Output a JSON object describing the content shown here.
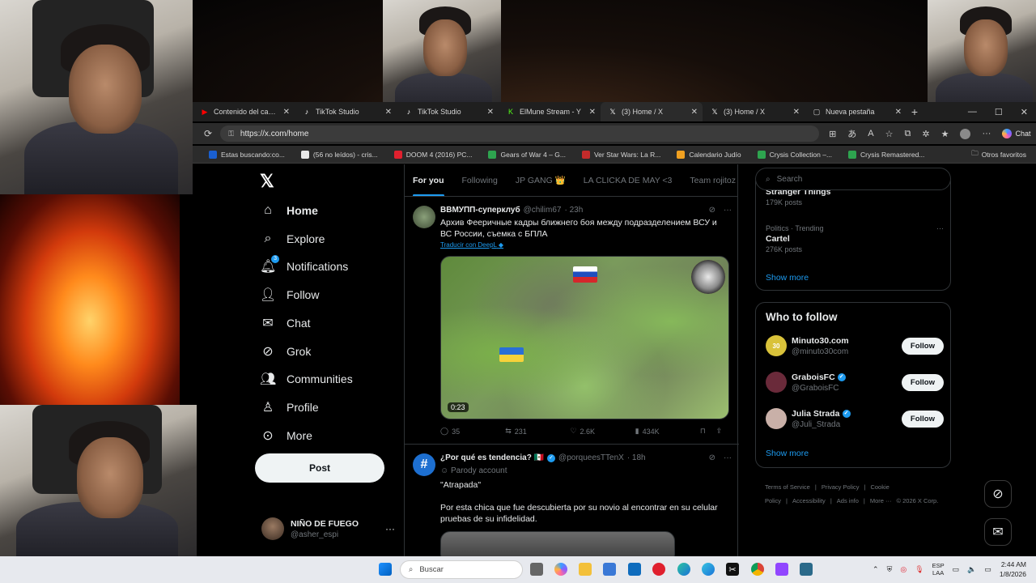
{
  "browser": {
    "tabs": [
      {
        "label": "Contenido del canal - Y",
        "icon": "youtube-icon",
        "color": "#ff0000"
      },
      {
        "label": "TikTok Studio",
        "icon": "tiktok-icon",
        "color": "#ffffff"
      },
      {
        "label": "TikTok Studio",
        "icon": "tiktok-icon",
        "color": "#ffffff"
      },
      {
        "label": "ElMune Stream - Y",
        "icon": "kick-icon",
        "color": "#53fc18"
      },
      {
        "label": "(3) Home / X",
        "icon": "x-icon",
        "color": "#ffffff"
      },
      {
        "label": "(3) Home / X",
        "icon": "x-icon",
        "color": "#ffffff"
      },
      {
        "label": "Nueva pestaña",
        "icon": "newtab-icon",
        "color": "#cccccc"
      }
    ],
    "active_tab_index": 4,
    "url": "https://x.com/home",
    "chat_label": "Chat",
    "bookmarks": [
      "Estas buscando:co...",
      "(56 no leídos) - cris...",
      "DOOM 4 (2016) PC...",
      "Gears of War 4 – G...",
      "Ver Star Wars: La R...",
      "Calendario Judío",
      "Crysis Collection –...",
      "Crysis Remastered..."
    ],
    "other_bookmarks": "Otros favoritos"
  },
  "x": {
    "nav": [
      {
        "label": "Home",
        "icon": "home-icon",
        "bold": true
      },
      {
        "label": "Explore",
        "icon": "search-icon"
      },
      {
        "label": "Notifications",
        "icon": "bell-icon",
        "badge": "3"
      },
      {
        "label": "Follow",
        "icon": "add-person-icon"
      },
      {
        "label": "Chat",
        "icon": "envelope-icon"
      },
      {
        "label": "Grok",
        "icon": "grok-icon"
      },
      {
        "label": "Communities",
        "icon": "people-icon"
      },
      {
        "label": "Profile",
        "icon": "person-icon"
      },
      {
        "label": "More",
        "icon": "more-circle-icon"
      }
    ],
    "post_label": "Post",
    "profile": {
      "name": "NIÑO DE FUEGO",
      "handle": "@asher_espi"
    },
    "feed_tabs": [
      "For you",
      "Following",
      "JP GANG 👑",
      "LA CLICKA DE MAY <3",
      "Team rojitoz"
    ],
    "tweets": [
      {
        "name": "ВВМУПП-суперклуб",
        "handle": "@chilim67",
        "time": "· 23h",
        "text": "Архив Фееричные кадры ближнего боя между подразделением ВСУ и ВС России, съемка с БПЛА",
        "translate": "Traducir con DeepL",
        "duration": "0:23",
        "stats": {
          "replies": "35",
          "reposts": "231",
          "likes": "2.6K",
          "views": "434K"
        }
      },
      {
        "name": "¿Por qué es tendencia? 🇲🇽",
        "handle": "@porqueesTTenX",
        "time": "· 18h",
        "parody": "Parody account",
        "quote": "\"Atrapada\"",
        "text": "Por esta chica que fue descubierta por su novio al encontrar en su celular pruebas de su infidelidad."
      }
    ],
    "search_placeholder": "Search",
    "trends": [
      {
        "category": "",
        "title": "Stranger Things",
        "posts": "179K posts"
      },
      {
        "category": "Politics · Trending",
        "title": "Cartel",
        "posts": "276K posts"
      }
    ],
    "show_more": "Show more",
    "who_to_follow_title": "Who to follow",
    "who_to_follow": [
      {
        "name": "Minuto30.com",
        "handle": "@minuto30com",
        "verified": false,
        "avatar_text": "30"
      },
      {
        "name": "GraboisFC",
        "handle": "@GraboisFC",
        "verified": true,
        "avatar_text": ""
      },
      {
        "name": "Julia Strada",
        "handle": "@Juli_Strada",
        "verified": true,
        "avatar_text": ""
      }
    ],
    "follow_label": "Follow",
    "footer": [
      "Terms of Service",
      "|",
      "Privacy Policy",
      "|",
      "Cookie Policy",
      "|",
      "Accessibility",
      "|",
      "Ads info",
      "|",
      "More ···",
      "© 2026 X Corp."
    ]
  },
  "taskbar": {
    "search_placeholder": "Buscar",
    "lang_top": "ESP",
    "lang_bottom": "LAA",
    "time": "2:44 AM",
    "date": "1/8/2026"
  }
}
